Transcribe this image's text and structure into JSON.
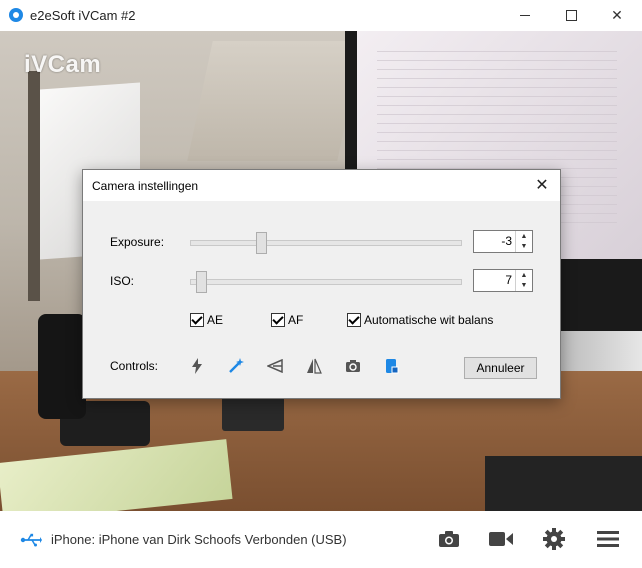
{
  "window": {
    "title": "e2eSoft iVCam #2"
  },
  "preview": {
    "watermark": "iVCam"
  },
  "dialog": {
    "title": "Camera instellingen",
    "exposure": {
      "label": "Exposure:",
      "value": "-3",
      "level": 0.25
    },
    "iso": {
      "label": "ISO:",
      "value": "7",
      "level": 0.02
    },
    "checks": [
      {
        "label": "AE",
        "checked": true
      },
      {
        "label": "AF",
        "checked": true
      },
      {
        "label": "Automatische wit balans",
        "checked": true
      }
    ],
    "controls_label": "Controls:",
    "controls": [
      "flash-icon",
      "magic-wand-icon",
      "mirror-horizontal-icon",
      "flip-icon",
      "camera-switch-icon",
      "lock-rotation-icon"
    ],
    "cancel_label": "Annuleer"
  },
  "status": {
    "text": "iPhone: iPhone van Dirk Schoofs Verbonden (USB)",
    "icons": [
      "camera-icon",
      "video-icon",
      "settings-icon",
      "menu-icon"
    ]
  },
  "colors": {
    "accent": "#1e88e5",
    "dialog_bg": "#f0f0f0",
    "icon_gray": "#444444"
  }
}
